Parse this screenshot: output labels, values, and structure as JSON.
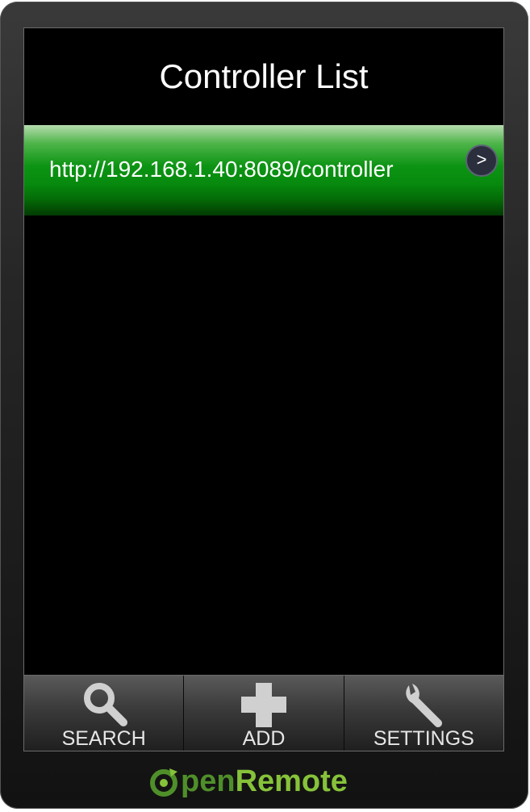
{
  "header": {
    "title": "Controller List"
  },
  "controllers": [
    {
      "url": "http://192.168.1.40:8089/controller",
      "action_glyph": ">"
    }
  ],
  "tabs": [
    {
      "label": "SEARCH",
      "icon": "search-icon"
    },
    {
      "label": "ADD",
      "icon": "plus-icon"
    },
    {
      "label": "SETTINGS",
      "icon": "wrench-icon"
    }
  ],
  "brand": {
    "part1": "pen",
    "part2": "Remote",
    "accent": "#86c23a"
  },
  "colors": {
    "row_accent": "#0d9414",
    "background": "#000000"
  }
}
